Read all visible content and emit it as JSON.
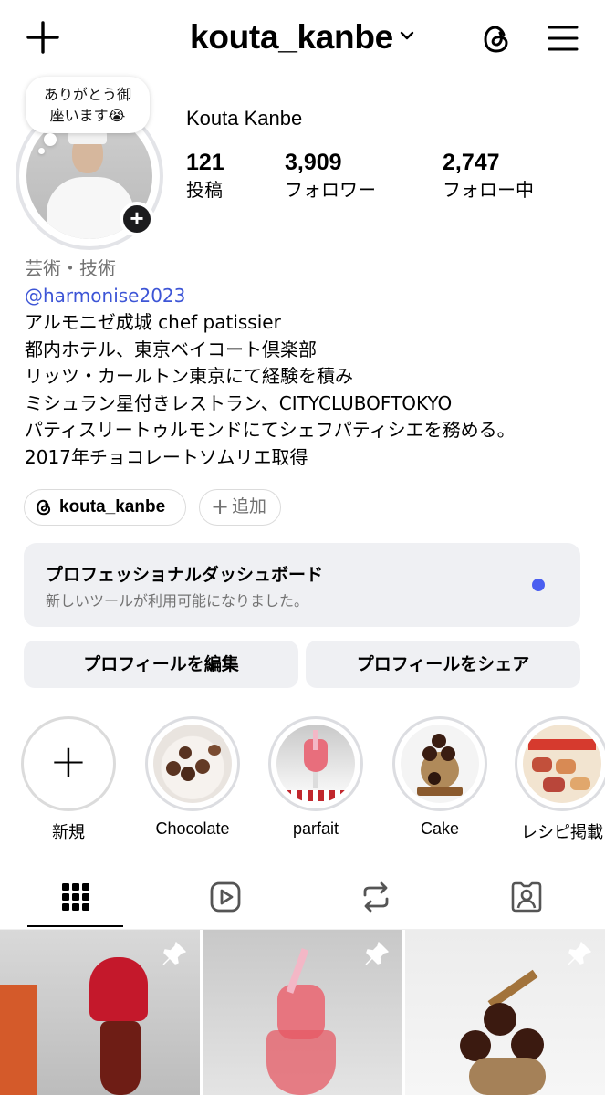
{
  "header": {
    "username": "kouta_kanbe"
  },
  "profile": {
    "note": "ありがとう御座います😭",
    "note_line1": "ありがとう御",
    "note_line2": "座います😭",
    "full_name": "Kouta Kanbe",
    "stats": [
      {
        "value": "121",
        "label": "投稿"
      },
      {
        "value": "3,909",
        "label": "フォロワー"
      },
      {
        "value": "2,747",
        "label": "フォロー中"
      }
    ],
    "category": "芸術・技術",
    "mention": "@harmonise2023",
    "bio_lines": [
      "アルモニゼ成城 chef patissier",
      "都内ホテル、東京ベイコート倶楽部",
      "リッツ・カールトン東京にて経験を積み",
      "ミシュラン星付きレストラン、CITYCLUBOFTOKYO",
      "パティスリートゥルモンドにてシェフパティシエを務める。",
      "2017年チョコレートソムリエ取得"
    ],
    "threads_chip": "kouta_kanbe",
    "add_chip": "追加"
  },
  "dashboard": {
    "title": "プロフェッショナルダッシュボード",
    "subtitle": "新しいツールが利用可能になりました。"
  },
  "buttons": {
    "edit": "プロフィールを編集",
    "share": "プロフィールをシェア"
  },
  "highlights": [
    {
      "label": "新規"
    },
    {
      "label": "Chocolate"
    },
    {
      "label": "parfait"
    },
    {
      "label": "Cake"
    },
    {
      "label": "レシピ掲載"
    }
  ],
  "tabs": [
    "grid-icon",
    "reels-icon",
    "reposts-icon",
    "tagged-icon"
  ],
  "colors": {
    "link": "#3d55d6",
    "dot": "#4a5ef0",
    "button_bg": "#eff0f3"
  }
}
